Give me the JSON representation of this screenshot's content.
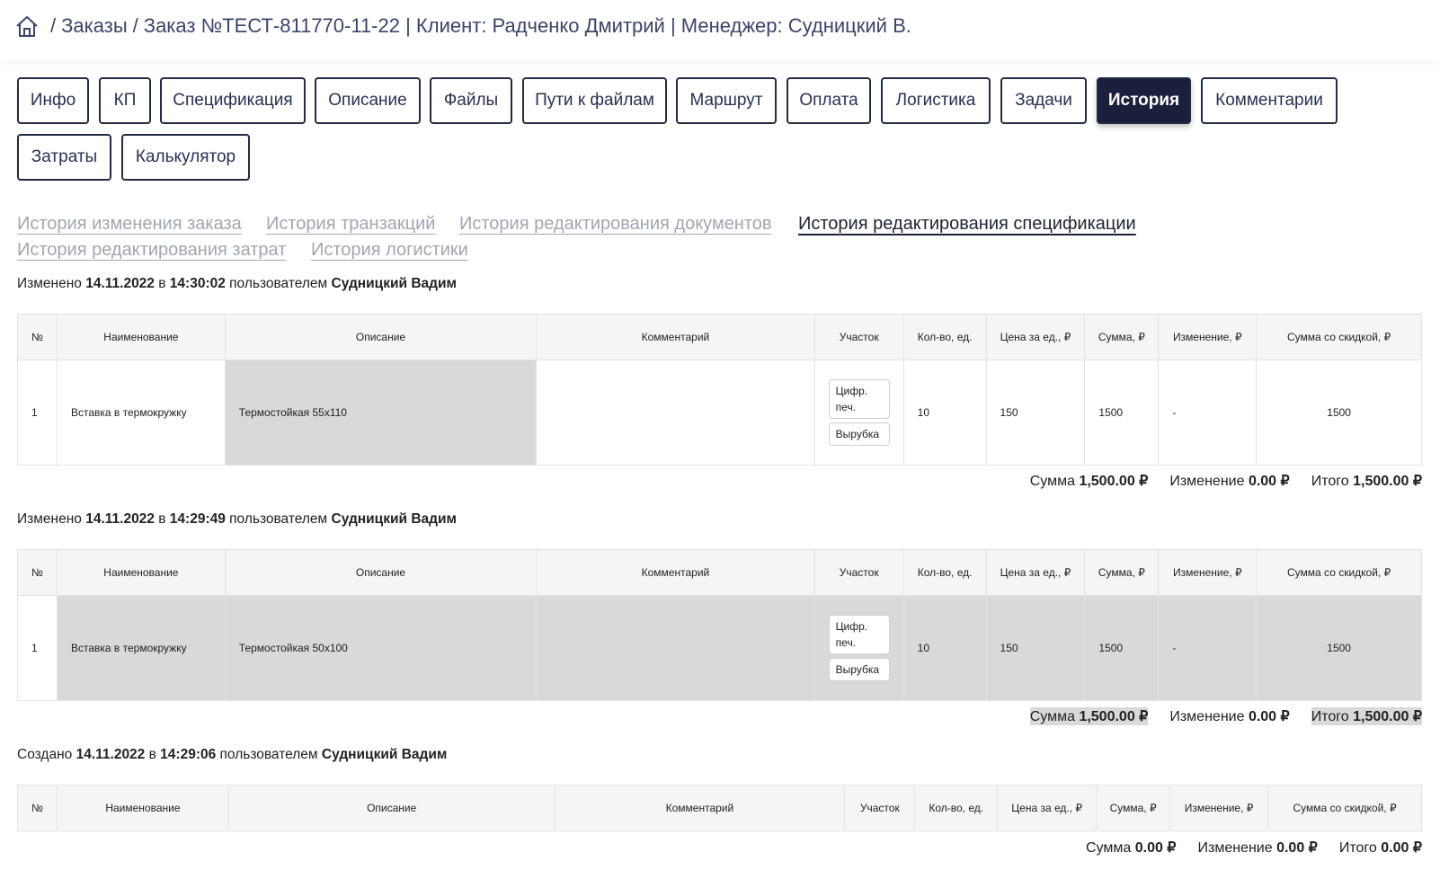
{
  "breadcrumb": {
    "home_icon": "home-icon",
    "separator": "/",
    "orders": "Заказы",
    "current": "Заказ №ТЕСТ-811770-11-22 | Клиент: Радченко Дмитрий | Менеджер: Судницкий В."
  },
  "tabs": [
    "Инфо",
    "КП",
    "Спецификация",
    "Описание",
    "Файлы",
    "Пути к файлам",
    "Маршрут",
    "Оплата",
    "Логистика",
    "Задачи",
    "История",
    "Комментарии",
    "Затраты",
    "Калькулятор"
  ],
  "active_tab": "История",
  "subtabs": [
    "История изменения заказа",
    "История транзакций",
    "История редактирования документов",
    "История редактирования спецификации",
    "История редактирования затрат",
    "История логистики"
  ],
  "active_subtab": "История редактирования спецификации",
  "table_headers": [
    "№",
    "Наименование",
    "Описание",
    "Комментарий",
    "Участок",
    "Кол-во, ед.",
    "Цена за ед., ₽",
    "Сумма, ₽",
    "Изменение, ₽",
    "Сумма со скидкой, ₽"
  ],
  "words": {
    "in": "в",
    "by_user": "пользователем",
    "sum": "Сумма",
    "change": "Изменение",
    "total": "Итого"
  },
  "entries": [
    {
      "action": "Изменено",
      "date": "14.11.2022",
      "time": "14:30:02",
      "user": "Судницкий Вадим",
      "row": {
        "n": "1",
        "name": "Вставка в термокружку",
        "description": "Термостойкая 55х110",
        "comment": "",
        "sections": [
          "Цифр. печ.",
          "Вырубка"
        ],
        "qty": "10",
        "price": "150",
        "sum": "1500",
        "change": "-",
        "discounted": "1500"
      },
      "totals": {
        "sum": "1,500.00 ₽",
        "change": "0.00 ₽",
        "total": "1,500.00 ₽"
      }
    },
    {
      "action": "Изменено",
      "date": "14.11.2022",
      "time": "14:29:49",
      "user": "Судницкий Вадим",
      "row": {
        "n": "1",
        "name": "Вставка в термокружку",
        "description": "Термостойкая 50х100",
        "comment": "",
        "sections": [
          "Цифр. печ.",
          "Вырубка"
        ],
        "qty": "10",
        "price": "150",
        "sum": "1500",
        "change": "-",
        "discounted": "1500"
      },
      "totals": {
        "sum": "1,500.00 ₽",
        "change": "0.00 ₽",
        "total": "1,500.00 ₽"
      }
    },
    {
      "action": "Создано",
      "date": "14.11.2022",
      "time": "14:29:06",
      "user": "Судницкий Вадим",
      "totals": {
        "sum": "0.00 ₽",
        "change": "0.00 ₽",
        "total": "0.00 ₽"
      }
    }
  ],
  "colors": {
    "accent_dark": "#1b1f3b",
    "highlight": "#d9d9d9",
    "muted_link": "#a2a6b2"
  }
}
